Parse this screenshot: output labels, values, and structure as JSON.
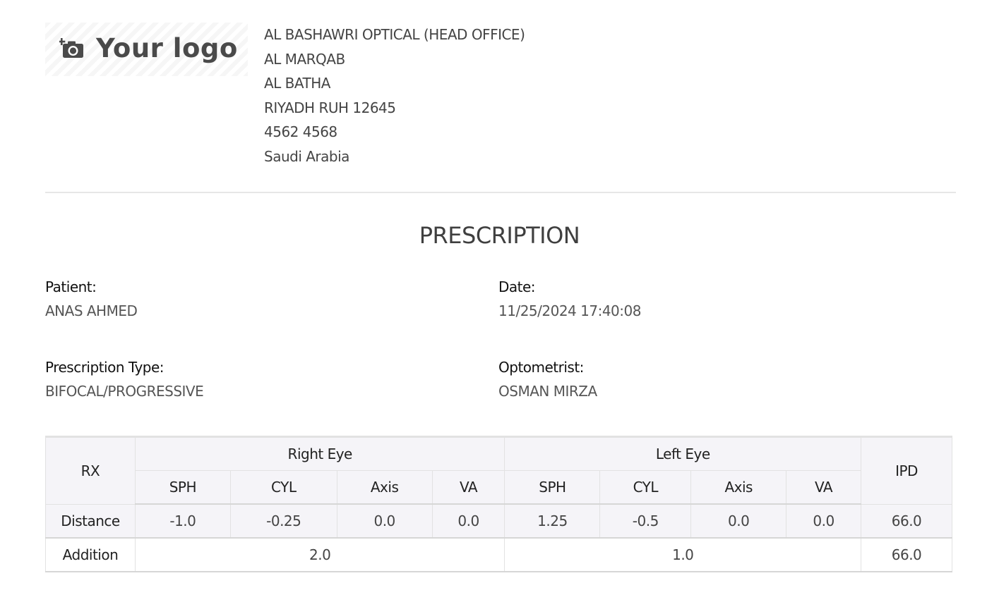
{
  "header": {
    "logo_text": "Your logo",
    "logo_icon": "camera-add-icon",
    "address_lines": [
      "AL BASHAWRI OPTICAL (HEAD OFFICE)",
      "AL MARQAB",
      "AL BATHA",
      "RIYADH RUH 12645",
      "4562 4568",
      "Saudi Arabia"
    ]
  },
  "title": "PRESCRIPTION",
  "fields": {
    "patient": {
      "label": "Patient:",
      "value": "ANAS AHMED"
    },
    "date": {
      "label": "Date:",
      "value": "11/25/2024 17:40:08"
    },
    "prescription_type": {
      "label": "Prescription Type:",
      "value": "BIFOCAL/PROGRESSIVE"
    },
    "optometrist": {
      "label": "Optometrist:",
      "value": "OSMAN MIRZA"
    }
  },
  "table": {
    "rx_header": "RX",
    "right_eye_header": "Right Eye",
    "left_eye_header": "Left Eye",
    "ipd_header": "IPD",
    "sub_headers": [
      "SPH",
      "CYL",
      "Axis",
      "VA"
    ],
    "distance": {
      "label": "Distance",
      "right": {
        "sph": "-1.0",
        "cyl": "-0.25",
        "axis": "0.0",
        "va": "0.0"
      },
      "left": {
        "sph": "1.25",
        "cyl": "-0.5",
        "axis": "0.0",
        "va": "0.0"
      },
      "ipd": "66.0"
    },
    "addition": {
      "label": "Addition",
      "right": "2.0",
      "left": "1.0",
      "ipd": "66.0"
    }
  },
  "colors": {
    "header_bg": "#f5f4f8",
    "divider": "#e7e7e7",
    "text_dark": "#222222",
    "text_muted": "#555555"
  }
}
